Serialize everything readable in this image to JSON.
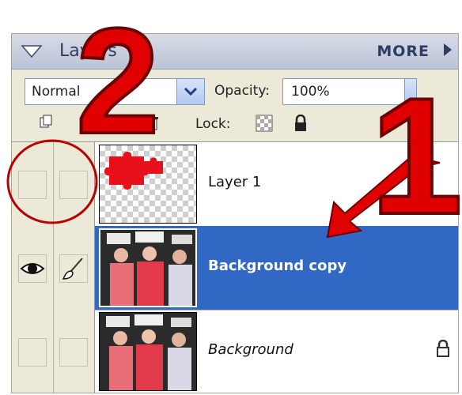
{
  "panel": {
    "title": "Layers",
    "more_label": "MORE",
    "blend_mode": "Normal",
    "opacity_label": "Opacity:",
    "opacity_value": "100%",
    "lock_label": "Lock:"
  },
  "layers": [
    {
      "name": "Layer 1",
      "visible": false,
      "selected": false,
      "italic": false,
      "locked": false
    },
    {
      "name": "Background copy",
      "visible": true,
      "selected": true,
      "italic": false,
      "locked": false
    },
    {
      "name": "Background",
      "visible": false,
      "selected": false,
      "italic": true,
      "locked": true
    }
  ],
  "annotations": {
    "number_1": "1",
    "number_2": "2"
  },
  "icons": {
    "collapse": "triangle-down-icon",
    "dropdown": "chevron-down-icon",
    "more": "triangle-right-icon",
    "new_layer": "new-layer-icon",
    "adjustment": "adjustment-layer-icon",
    "trash": "trash-icon",
    "lock_transparency": "lock-transparency-icon",
    "lock_all": "padlock-icon",
    "eye": "eye-icon",
    "brush": "brush-icon"
  },
  "colors": {
    "selection": "#3168c4",
    "panel_bg": "#ece9d8",
    "annotation_red": "#e00000",
    "puzzle_red": "#e8101a"
  }
}
